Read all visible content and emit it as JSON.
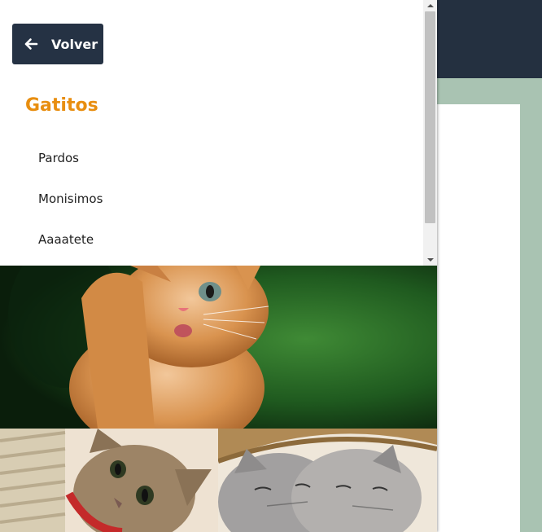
{
  "drawer": {
    "back_button": {
      "label": "Volver",
      "icon": "arrow-left-icon"
    },
    "title": "Gatitos",
    "items": [
      {
        "label": "Pardos"
      },
      {
        "label": "Monisimos"
      },
      {
        "label": "Aaaatete"
      }
    ]
  },
  "colors": {
    "header": "#243040",
    "page_background": "#a9c3b2",
    "button": "#253244",
    "title_accent": "#e88e10"
  },
  "gallery": {
    "photos": [
      {
        "subject": "orange-kitten-paw-raised"
      },
      {
        "subject": "tabby-kitten-red-collar"
      },
      {
        "subject": "two-grey-kittens-in-basket"
      }
    ]
  }
}
